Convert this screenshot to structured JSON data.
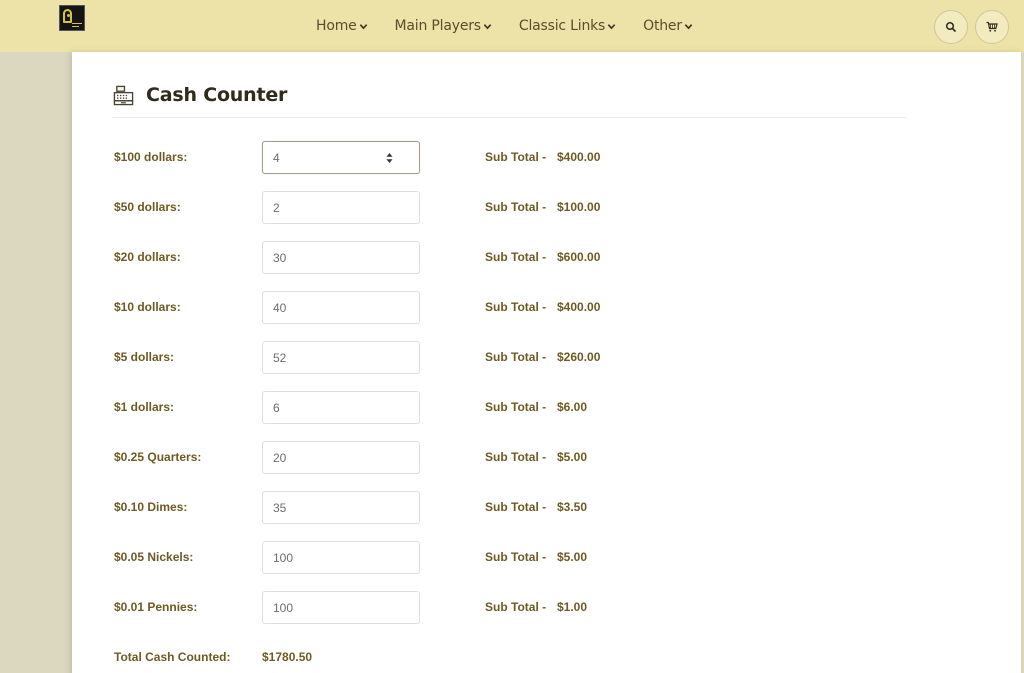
{
  "nav": {
    "items": [
      {
        "label": "Home"
      },
      {
        "label": "Main Players"
      },
      {
        "label": "Classic Links"
      },
      {
        "label": "Other"
      }
    ]
  },
  "icons": {
    "logo": "brand-logo",
    "search": "search-icon",
    "cart": "cart-icon",
    "register": "cash-register-icon",
    "chevron": "chevron-down-icon"
  },
  "colors": {
    "topbar": "#ede3a8",
    "label": "#6e5a23",
    "background": "#dcd7bf"
  },
  "page": {
    "title": "Cash Counter"
  },
  "counter": {
    "subtotal_label": "Sub Total -",
    "rows": [
      {
        "label": "$100 dollars:",
        "value": "4",
        "subtotal": "$400.00"
      },
      {
        "label": "$50 dollars:",
        "value": "2",
        "subtotal": "$100.00"
      },
      {
        "label": "$20 dollars:",
        "value": "30",
        "subtotal": "$600.00"
      },
      {
        "label": "$10 dollars:",
        "value": "40",
        "subtotal": "$400.00"
      },
      {
        "label": "$5 dollars:",
        "value": "52",
        "subtotal": "$260.00"
      },
      {
        "label": "$1 dollars:",
        "value": "6",
        "subtotal": "$6.00"
      },
      {
        "label": "$0.25 Quarters:",
        "value": "20",
        "subtotal": "$5.00"
      },
      {
        "label": "$0.10 Dimes:",
        "value": "35",
        "subtotal": "$3.50"
      },
      {
        "label": "$0.05 Nickels:",
        "value": "100",
        "subtotal": "$5.00"
      },
      {
        "label": "$0.01 Pennies:",
        "value": "100",
        "subtotal": "$1.00"
      }
    ],
    "total_label": "Total Cash Counted:",
    "total_value": "$1780.50"
  }
}
